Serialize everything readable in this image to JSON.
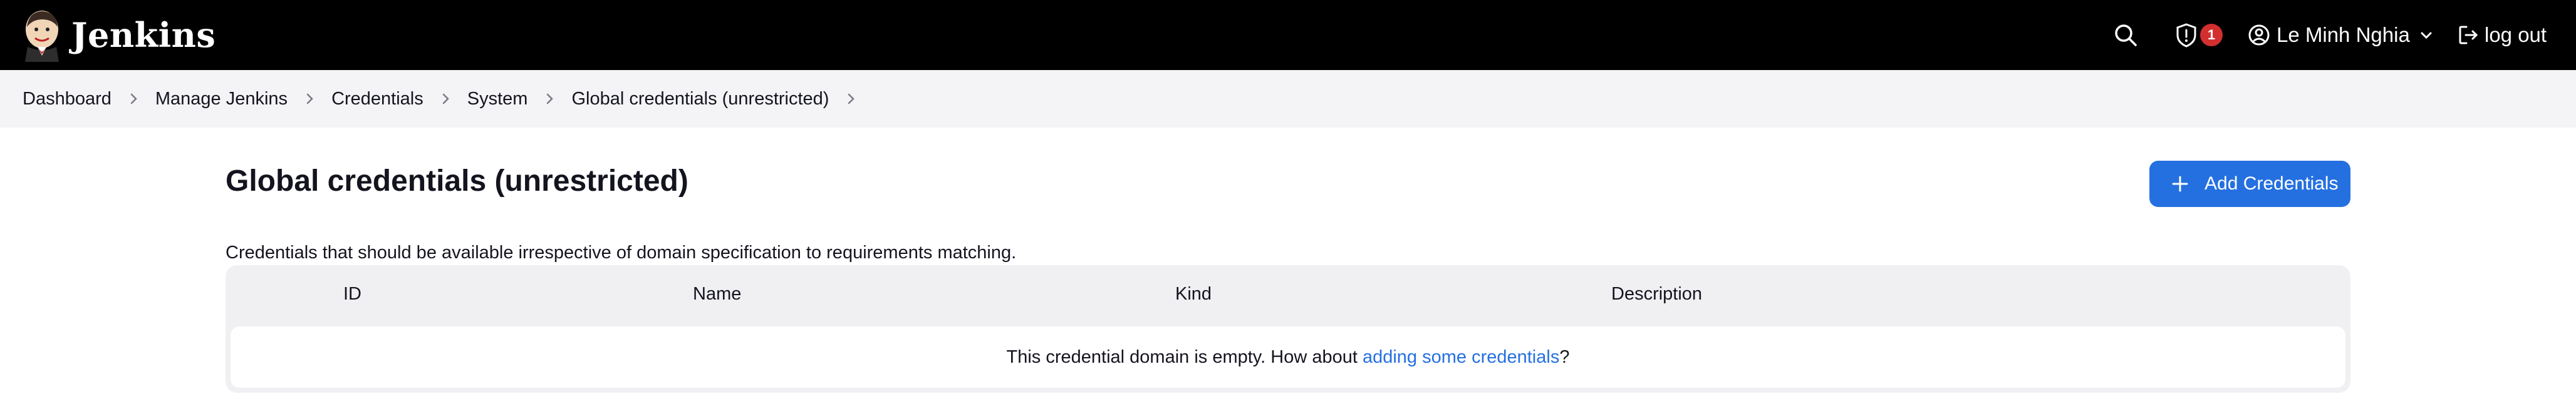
{
  "header": {
    "brand": "Jenkins",
    "security_count": "1",
    "user_name": "Le Minh Nghia",
    "logout_label": "log out"
  },
  "breadcrumbs": [
    {
      "label": "Dashboard"
    },
    {
      "label": "Manage Jenkins"
    },
    {
      "label": "Credentials"
    },
    {
      "label": "System"
    },
    {
      "label": "Global credentials (unrestricted)"
    }
  ],
  "main": {
    "title": "Global credentials (unrestricted)",
    "add_button_label": "Add Credentials",
    "description": "Credentials that should be available irrespective of domain specification to requirements matching.",
    "table": {
      "columns": [
        "ID",
        "Name",
        "Kind",
        "Description"
      ],
      "empty_prefix": "This credential domain is empty. How about ",
      "empty_link": "adding some credentials",
      "empty_suffix": "?"
    }
  },
  "colors": {
    "header_bg": "#000000",
    "accent": "#2470e0",
    "badge": "#d32f2f",
    "breadcrumb_bg": "#f4f4f6"
  },
  "icons": {
    "logo": "jenkins-butler-logo",
    "search": "search-icon",
    "security": "shield-alert-icon",
    "user": "user-circle-icon",
    "user_menu": "chevron-down-icon",
    "logout": "logout-icon",
    "breadcrumb_sep": "chevron-right-icon",
    "add": "plus-icon"
  }
}
